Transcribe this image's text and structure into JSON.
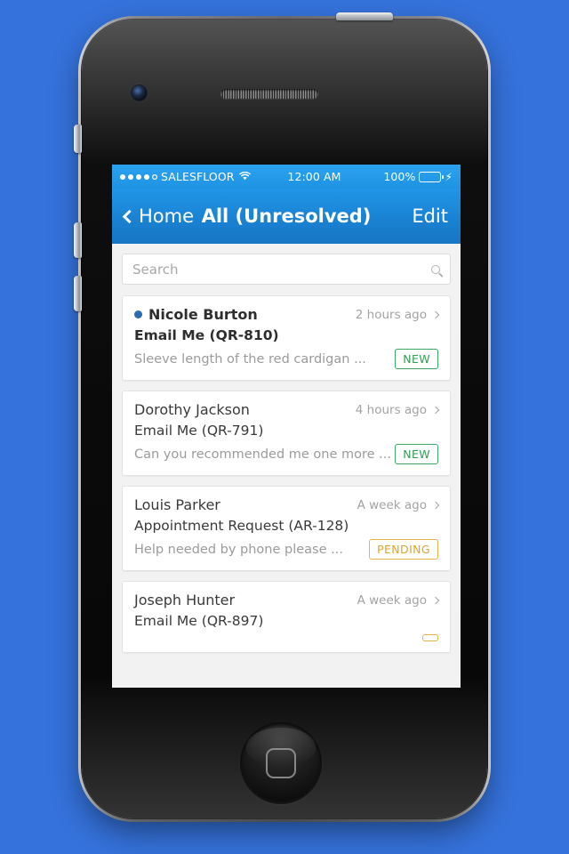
{
  "status_bar": {
    "signal_dots": [
      "filled",
      "filled",
      "filled",
      "filled",
      "hollow"
    ],
    "carrier": "SALESFLOOR",
    "wifi_icon": "wifi-icon",
    "time": "12:00 AM",
    "battery_percent": "100%",
    "battery_icon": "battery-full-icon",
    "charging_icon": "lightning-bolt-icon",
    "battery_color": "#4cd964"
  },
  "navbar": {
    "back_icon": "chevron-left-icon",
    "back_label": "Home",
    "title": "All (Unresolved)",
    "edit_label": "Edit",
    "background_color": "#1a82d2"
  },
  "search": {
    "placeholder": "Search",
    "value": "",
    "icon": "search-icon"
  },
  "list": {
    "items": [
      {
        "unread": true,
        "name": "Nicole Burton",
        "time": "2 hours ago",
        "subject": "Email Me (QR-810)",
        "preview": "Sleeve length of the red cardigan ...",
        "badge": "NEW",
        "badge_type": "new",
        "chevron_icon": "chevron-right-icon",
        "unread_dot_icon": "unread-dot-icon"
      },
      {
        "unread": false,
        "name": "Dorothy Jackson",
        "time": "4 hours ago",
        "subject": "Email Me (QR-791)",
        "preview": "Can you recommended me one more ...",
        "badge": "NEW",
        "badge_type": "new",
        "chevron_icon": "chevron-right-icon"
      },
      {
        "unread": false,
        "name": "Louis Parker",
        "time": "A week ago",
        "subject": "Appointment Request (AR-128)",
        "preview": "Help needed by phone please ...",
        "badge": "PENDING",
        "badge_type": "pending",
        "chevron_icon": "chevron-right-icon"
      },
      {
        "unread": false,
        "name": "Joseph Hunter",
        "time": "A week ago",
        "subject": "Email Me (QR-897)",
        "preview": "",
        "badge": "",
        "badge_type": "pending",
        "chevron_icon": "chevron-right-icon"
      }
    ]
  },
  "badge_colors": {
    "new": "#2e9e52",
    "pending": "#e0a32b"
  },
  "device": {
    "home_button_icon": "home-button-icon",
    "camera_icon": "front-camera-icon",
    "speaker_icon": "earpiece-speaker-icon",
    "power_button_icon": "power-button-icon",
    "mute_switch_icon": "mute-switch-icon",
    "volume_up_icon": "volume-up-button-icon",
    "volume_down_icon": "volume-down-button-icon"
  },
  "background_color": "#3572db"
}
